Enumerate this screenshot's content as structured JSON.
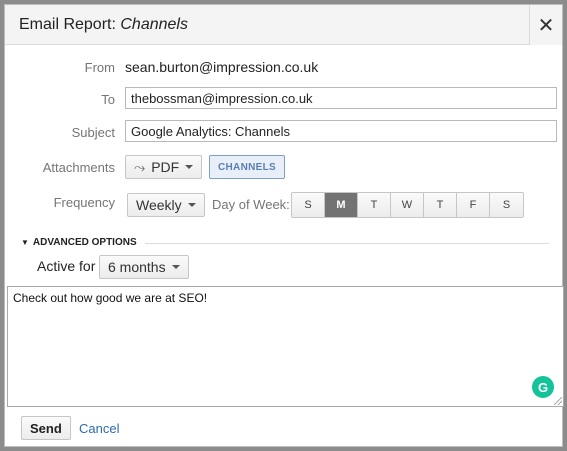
{
  "dialog": {
    "title_prefix": "Email Report: ",
    "title_report": "Channels",
    "close_glyph": "✕"
  },
  "form": {
    "from_label": "From",
    "from_value": "sean.burton@impression.co.uk",
    "to_label": "To",
    "to_value": "thebossman@impression.co.uk",
    "subject_label": "Subject",
    "subject_value": "Google Analytics: Channels",
    "attachments_label": "Attachments",
    "attachment_format": "PDF",
    "attachment_chip": "CHANNELS",
    "frequency_label": "Frequency",
    "frequency_value": "Weekly",
    "day_of_week_label": "Day of Week:",
    "days": [
      "S",
      "M",
      "T",
      "W",
      "T",
      "F",
      "S"
    ],
    "selected_day_index": 1
  },
  "advanced": {
    "header": "ADVANCED OPTIONS",
    "active_for_label": "Active for",
    "active_for_value": "6 months"
  },
  "message": {
    "text": "Check out how good we are at SEO!",
    "grammarly_glyph": "G"
  },
  "footer": {
    "send_label": "Send",
    "cancel_label": "Cancel"
  },
  "icons": {
    "close": "close-icon",
    "pdf": "pdf-icon",
    "caret": "chevron-down-icon",
    "advanced_toggle": "triangle-down-icon",
    "grammarly": "grammarly-icon"
  }
}
